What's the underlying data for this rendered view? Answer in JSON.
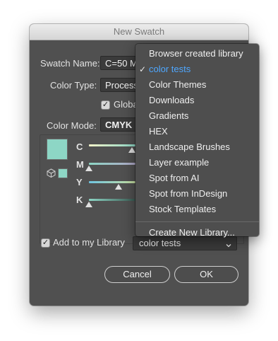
{
  "dialog": {
    "title": "New Swatch",
    "swatch_name_label": "Swatch Name:",
    "swatch_name_value": "C=50 M",
    "color_type_label": "Color Type:",
    "color_type_value": "Process",
    "global_label": "Globa",
    "color_mode_label": "Color Mode:",
    "color_mode_value": "CMYK",
    "sliders": [
      {
        "label": "C"
      },
      {
        "label": "M"
      },
      {
        "label": "Y"
      },
      {
        "label": "K"
      }
    ],
    "swatch_color": "#8dd6c5",
    "add_to_library_label": "Add to my Library",
    "library_value": "color tests",
    "cancel_label": "Cancel",
    "ok_label": "OK"
  },
  "library_menu": {
    "items": [
      {
        "label": "Browser created library",
        "selected": false
      },
      {
        "label": "color tests",
        "selected": true
      },
      {
        "label": "Color Themes",
        "selected": false
      },
      {
        "label": "Downloads",
        "selected": false
      },
      {
        "label": "Gradients",
        "selected": false
      },
      {
        "label": "HEX",
        "selected": false
      },
      {
        "label": "Landscape Brushes",
        "selected": false
      },
      {
        "label": "Layer example",
        "selected": false
      },
      {
        "label": "Spot from AI",
        "selected": false
      },
      {
        "label": "Spot from InDesign",
        "selected": false
      },
      {
        "label": "Stock Templates",
        "selected": false
      }
    ],
    "create_label": "Create New Library...",
    "checkmark": "✓"
  },
  "colors": {
    "accent": "#4ea7ff",
    "dialog_bg": "#505050"
  }
}
